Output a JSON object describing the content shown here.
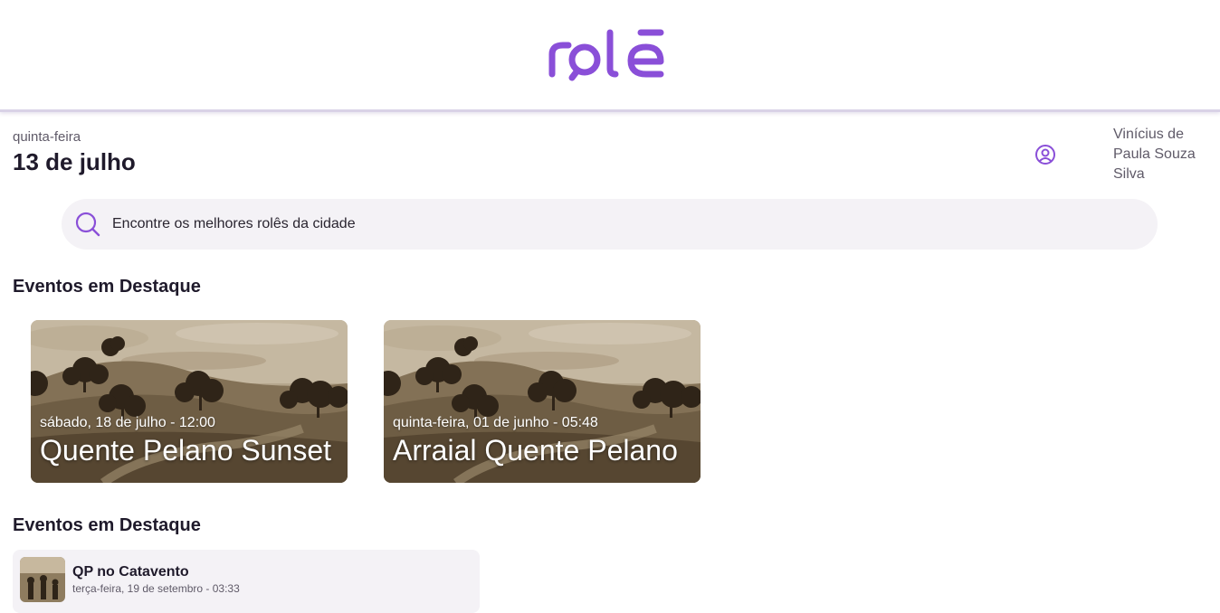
{
  "header": {
    "logo_text": "rolê",
    "brand_color": "#8a4fd8"
  },
  "date": {
    "weekday": "quinta-feira",
    "day": "13 de julho"
  },
  "user": {
    "icon": "user-circle-icon",
    "name": "Vinícius de Paula Souza Silva"
  },
  "search": {
    "placeholder": "Encontre os melhores rolês da cidade",
    "value": "",
    "icon": "search-icon"
  },
  "featured": {
    "title": "Eventos em Destaque",
    "cards": [
      {
        "date": "sábado, 18 de julho - 12:00",
        "title": "Quente Pelano Sunset"
      },
      {
        "date": "quinta-feira, 01 de junho - 05:48",
        "title": "Arraial Quente Pelano"
      }
    ]
  },
  "list": {
    "title": "Eventos em Destaque",
    "items": [
      {
        "title": "QP no Catavento",
        "date": "terça-feira, 19 de setembro - 03:33"
      }
    ]
  }
}
